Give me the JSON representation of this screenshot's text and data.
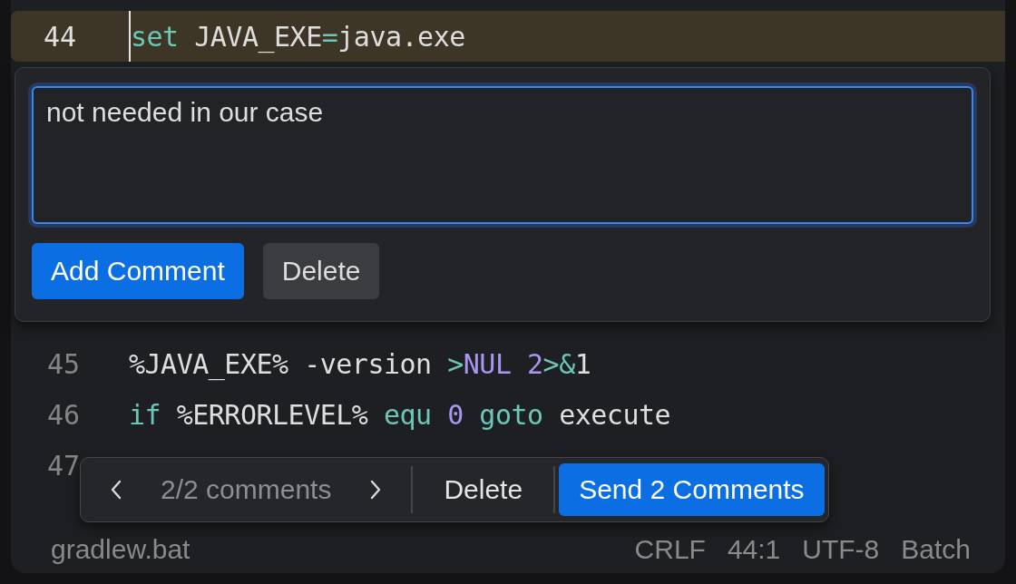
{
  "editor": {
    "lines": [
      {
        "number": "44",
        "current": true,
        "tokens": [
          {
            "text": "set",
            "kind": "keyword"
          },
          {
            "text": " JAVA_EXE",
            "kind": "plain"
          },
          {
            "text": "=",
            "kind": "keyword"
          },
          {
            "text": "java.exe",
            "kind": "plain"
          }
        ],
        "comment": {
          "value": "not needed in our case",
          "buttons": [
            {
              "label": "Add Comment",
              "kind": "primary"
            },
            {
              "label": "Delete",
              "kind": "secondary"
            }
          ]
        }
      },
      {
        "number": "45",
        "current": false,
        "tokens": [
          {
            "text": "%JAVA_EXE% -version ",
            "kind": "plain"
          },
          {
            "text": ">",
            "kind": "keyword"
          },
          {
            "text": "NUL 2",
            "kind": "literal"
          },
          {
            "text": ">&",
            "kind": "keyword"
          },
          {
            "text": "1",
            "kind": "plain"
          }
        ]
      },
      {
        "number": "46",
        "current": false,
        "tokens": [
          {
            "text": "if",
            "kind": "keyword"
          },
          {
            "text": " %ERRORLEVEL% ",
            "kind": "plain"
          },
          {
            "text": "equ",
            "kind": "keyword"
          },
          {
            "text": " 0",
            "kind": "literal"
          },
          {
            "text": " goto",
            "kind": "keyword"
          },
          {
            "text": " execute",
            "kind": "plain"
          }
        ]
      },
      {
        "number": "47",
        "current": false
      }
    ]
  },
  "review_bar": {
    "counter": "2/2 comments",
    "buttons": [
      {
        "label": "Delete",
        "kind": "plain"
      },
      {
        "label": "Send 2 Comments",
        "kind": "primary"
      }
    ]
  },
  "status_bar": {
    "file": "gradlew.bat",
    "items": [
      "CRLF",
      "44:1",
      "UTF-8",
      "Batch"
    ]
  }
}
